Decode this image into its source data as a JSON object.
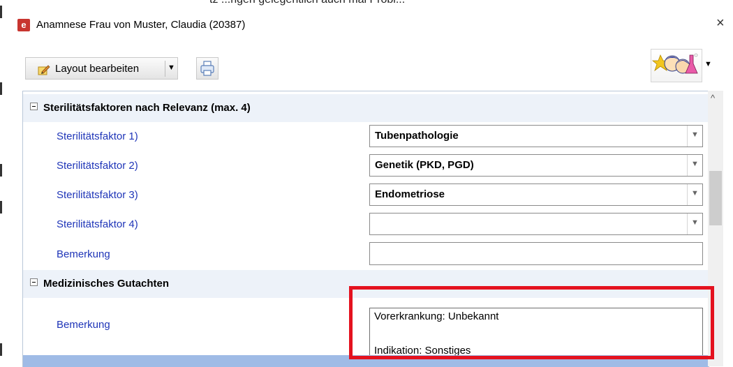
{
  "window": {
    "title": "Anamnese Frau von Muster, Claudia (20387)",
    "close_icon": "×"
  },
  "toolbar": {
    "layout_label": "Layout bearbeiten",
    "dropdown_arrow": "▼"
  },
  "sections": [
    {
      "title": "Sterilitätsfaktoren nach Relevanz (max. 4)",
      "rows": [
        {
          "label": "Sterilitätsfaktor 1)",
          "value": "Tubenpathologie"
        },
        {
          "label": "Sterilitätsfaktor 2)",
          "value": "Genetik (PKD, PGD)"
        },
        {
          "label": "Sterilitätsfaktor 3)",
          "value": "Endometriose"
        },
        {
          "label": "Sterilitätsfaktor 4)",
          "value": ""
        },
        {
          "label": "Bemerkung",
          "value": ""
        }
      ]
    },
    {
      "title": "Medizinisches Gutachten",
      "rows": [
        {
          "label": "Bemerkung",
          "lines": [
            "Vorerkrankung: Unbekannt",
            "Indikation: Sonstiges"
          ]
        }
      ]
    }
  ],
  "scroll": {
    "up_arrow": "^"
  },
  "colors": {
    "label_blue": "#1f35b8",
    "section_bg": "#edf2f9",
    "highlight_red": "#e4121f",
    "app_icon_red": "#c8352f"
  },
  "icons": [
    "app-logo-icon",
    "close-icon",
    "pencil-icon",
    "chevron-down-icon",
    "printer-icon",
    "profile-avatars-icon"
  ]
}
